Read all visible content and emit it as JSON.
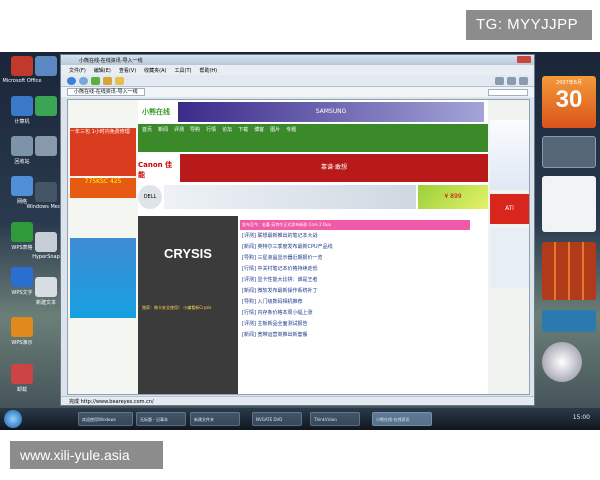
{
  "watermarks": {
    "top": "TG: MYYJJPP",
    "bottom": "www.xili-yule.asia"
  },
  "window": {
    "title": "小熊在线-在线资讯-导入一线",
    "menu": [
      "文件(F)",
      "编辑(E)",
      "查看(V)",
      "收藏夹(A)",
      "工具(T)",
      "帮助(H)"
    ],
    "tab_label": "小熊在线-在线资讯-导入一线",
    "status_text": "完成 http://www.beareyes.com.cn/",
    "zoom": "100%"
  },
  "page": {
    "banner_left": "小熊在线",
    "samsung": "SAMSUNG",
    "left_ad": "一年三包 1小时内免费修理",
    "left_price": "775KSC 425",
    "canon": "Canon 佳能",
    "canon_slogan": "靠谱·敢想",
    "dell": "DELL",
    "price_badge": "¥ 899",
    "ati": "ATi",
    "crysis": "CRYSIS",
    "crysis_caption": "独家：做卡安全使用！ 小编看新Crysis",
    "pink_bar": "发布至今：宏碁·英特尔正式发布新款 Core 2 Duo",
    "nav_items": [
      "首页",
      "新闻",
      "评测",
      "导购",
      "行情",
      "论坛",
      "下载",
      "博客",
      "图片",
      "专题"
    ],
    "news_items": [
      "[评测] 联想最新推出的笔记本大战",
      "[新闻] 英特尔三季度发布最新CPU产品线",
      "[导购] 三星液晶显示器近期报价一览",
      "[行情] 中关村笔记本价格持续走低",
      "[评测] 显卡性能大比拼：谁是王者",
      "[新闻] 微软发布最新操作系统补丁",
      "[导购] 入门级数码相机推荐",
      "[行情] 内存条价格本周小幅上涨",
      "[评测] 主板新品全面测试报告",
      "[新闻] 宽带运营商推出新套餐"
    ]
  },
  "desktop_icons": [
    {
      "label": "Microsoft Office"
    },
    {
      "label": "计算机"
    },
    {
      "label": "回收站"
    },
    {
      "label": "网络"
    },
    {
      "label": "Windows Media"
    },
    {
      "label": "WPS表格"
    },
    {
      "label": "HyperSnap"
    },
    {
      "label": "WPS文字"
    },
    {
      "label": "新建文本"
    },
    {
      "label": "WPS演示"
    },
    {
      "label": "卸载"
    }
  ],
  "gadgets": {
    "calendar_month": "2007年6月",
    "calendar_day": "30",
    "clock": "15:00"
  },
  "taskbar": [
    "欢迎使用Windows",
    "无标题 - 记事本",
    "新建文件夹",
    "NVGATE DVD",
    "ThinkVision",
    "小熊在线-在线资讯"
  ],
  "taskbar_right": "15:00"
}
